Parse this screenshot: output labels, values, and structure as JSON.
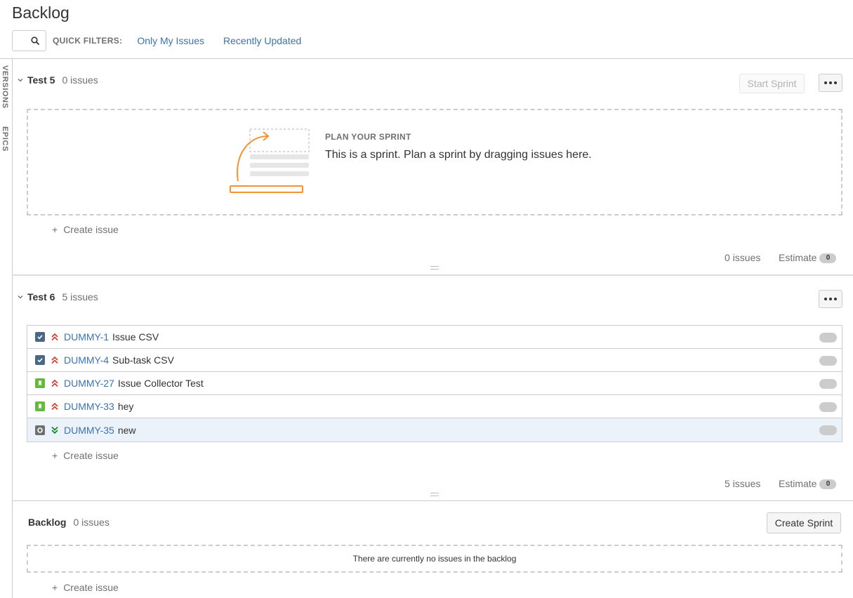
{
  "page": {
    "title": "Backlog"
  },
  "filters": {
    "label": "QUICK FILTERS:",
    "links": [
      "Only My Issues",
      "Recently Updated"
    ]
  },
  "side_tabs": [
    "VERSIONS",
    "EPICS"
  ],
  "sprint1": {
    "name": "Test 5",
    "count": "0 issues",
    "start_label": "Start Sprint",
    "plan_title": "PLAN YOUR SPRINT",
    "plan_text": "This is a sprint. Plan a sprint by dragging issues here.",
    "create_issue": "Create issue",
    "footer_count": "0 issues",
    "estimate_label": "Estimate",
    "estimate_value": "0"
  },
  "sprint2": {
    "name": "Test 6",
    "count": "5 issues",
    "issues": [
      {
        "key": "DUMMY-1",
        "summary": "Issue CSV",
        "type": "task",
        "priority": "highest"
      },
      {
        "key": "DUMMY-4",
        "summary": "Sub-task CSV",
        "type": "task",
        "priority": "highest"
      },
      {
        "key": "DUMMY-27",
        "summary": "Issue Collector Test",
        "type": "story",
        "priority": "highest"
      },
      {
        "key": "DUMMY-33",
        "summary": "hey",
        "type": "story",
        "priority": "highest"
      },
      {
        "key": "DUMMY-35",
        "summary": "new",
        "type": "other",
        "priority": "lowest"
      }
    ],
    "create_issue": "Create issue",
    "footer_count": "5 issues",
    "estimate_label": "Estimate",
    "estimate_value": "0"
  },
  "backlog": {
    "name": "Backlog",
    "count": "0 issues",
    "create_sprint_label": "Create Sprint",
    "empty_text": "There are currently no issues in the backlog",
    "create_issue": "Create issue"
  },
  "colors": {
    "link": "#3b73af",
    "priority_high": "#d04437",
    "priority_low": "#14892c",
    "plan_orange": "#f79232"
  }
}
